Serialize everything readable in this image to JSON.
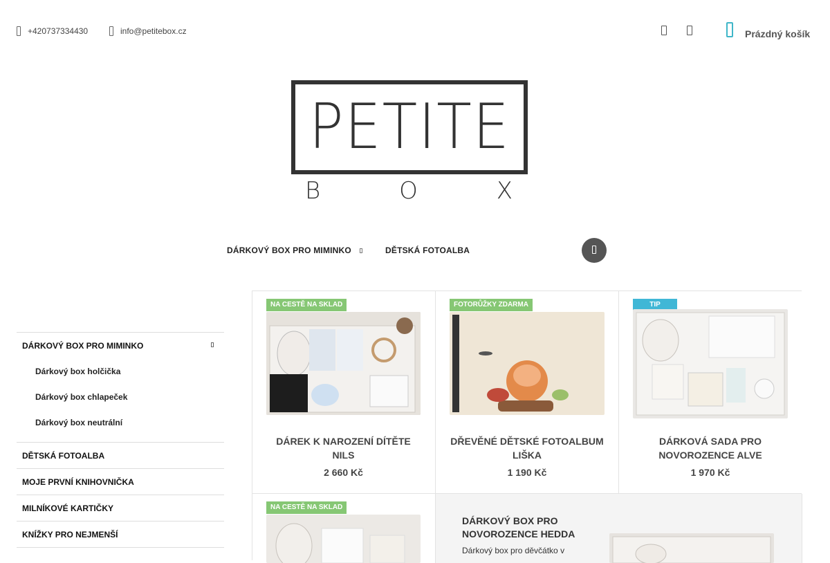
{
  "header": {
    "phone": "+420737334430",
    "email": "info@petitebox.cz",
    "cart_label": "Prázdný košík"
  },
  "logo": {
    "word": "PETITE",
    "sub": [
      "B",
      "O",
      "X"
    ]
  },
  "nav": {
    "items": [
      {
        "label": "DÁRKOVÝ BOX PRO MIMINKO"
      },
      {
        "label": "DĚTSKÁ FOTOALBA"
      }
    ]
  },
  "sidebar": {
    "categories": [
      {
        "label": "DÁRKOVÝ BOX PRO MIMINKO",
        "sub": [
          "Dárkový box holčička",
          "Dárkový box chlapeček",
          "Dárkový box neutrální"
        ]
      },
      {
        "label": "DĚTSKÁ FOTOALBA"
      },
      {
        "label": "MOJE PRVNÍ KNIHOVNIČKA"
      },
      {
        "label": "MILNÍKOVÉ KARTIČKY"
      },
      {
        "label": "KNÍŽKY PRO NEJMENŠÍ"
      }
    ]
  },
  "products": [
    {
      "flag": "NA CESTĚ NA SKLAD",
      "flag_color": "#86c774",
      "name": "DÁREK K NAROZENÍ DÍTĚTE NILS",
      "price": "2 660 Kč"
    },
    {
      "flag": "FOTORŮŽKY ZDARMA",
      "flag_color": "#86c774",
      "name": "DŘEVĚNÉ DĚTSKÉ FOTOALBUM LIŠKA",
      "price": "1 190 Kč"
    },
    {
      "flag": "TIP",
      "flag_color": "#40b7d6",
      "name": "DÁRKOVÁ SADA PRO NOVOROZENCE ALVE",
      "price": "1 970 Kč"
    },
    {
      "flag": "NA CESTĚ NA SKLAD",
      "flag_color": "#86c774",
      "name": "",
      "price": ""
    }
  ],
  "featured": {
    "title": "DÁRKOVÝ BOX PRO NOVOROZENCE HEDDA",
    "desc": "Dárkový box pro děvčátko v"
  },
  "icons": [
    "phone-icon",
    "email-icon",
    "user-icon",
    "heart-icon",
    "cart-icon",
    "search-icon",
    "chevron-down-icon"
  ]
}
